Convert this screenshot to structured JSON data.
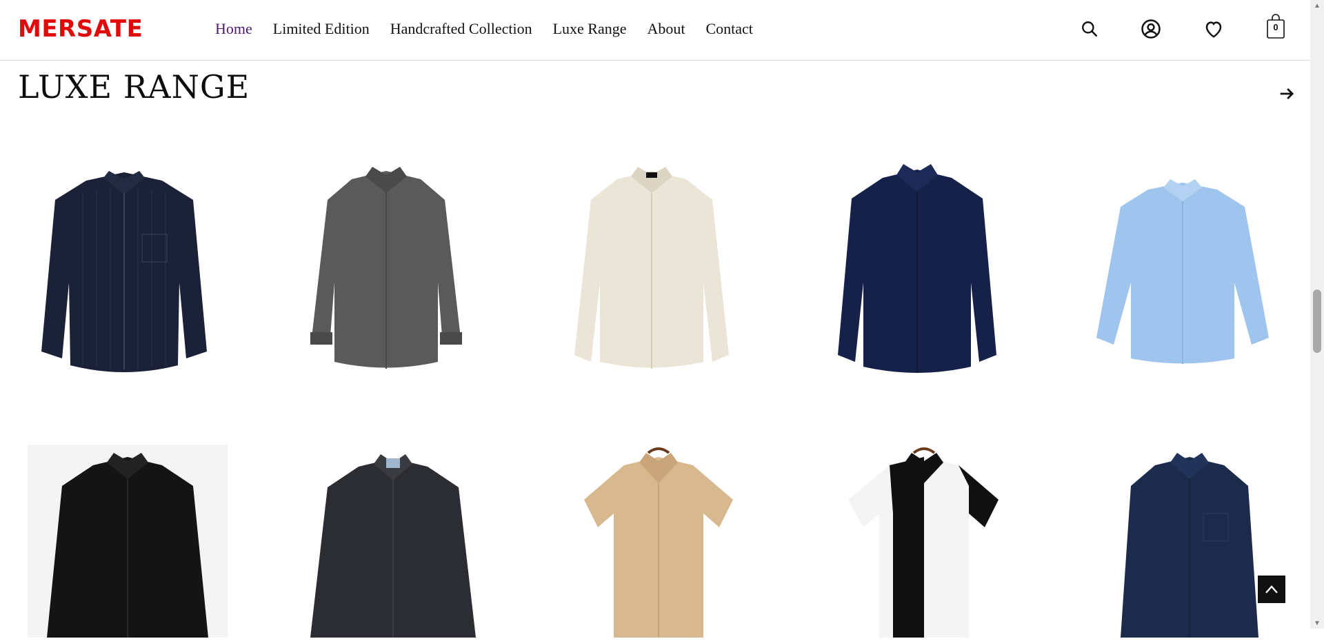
{
  "brand": {
    "logo_text": "MERSATE",
    "color": "#e10a0a"
  },
  "nav": {
    "items": [
      {
        "label": "Home",
        "active": true
      },
      {
        "label": "Limited Edition"
      },
      {
        "label": "Handcrafted Collection"
      },
      {
        "label": "Luxe Range"
      },
      {
        "label": "About"
      },
      {
        "label": "Contact"
      }
    ],
    "active_color": "#4b1a6e"
  },
  "header_icons": {
    "search": "search-icon",
    "account": "user-icon",
    "wishlist": "heart-icon",
    "cart": "shopping-bag-icon",
    "cart_count": "0"
  },
  "section": {
    "title": "LUXE RANGE",
    "next_icon": "arrow-right-icon"
  },
  "products": [
    {
      "name": "navy-pinstripe-shirt",
      "color": "#1b2136"
    },
    {
      "name": "charcoal-grey-shirt",
      "color": "#5a5a5a"
    },
    {
      "name": "beige-linen-shirt",
      "color": "#ebe5d8"
    },
    {
      "name": "navy-dress-shirt",
      "color": "#16214a"
    },
    {
      "name": "light-blue-shirt",
      "color": "#9fc5ee"
    },
    {
      "name": "black-shirt",
      "color": "#141414"
    },
    {
      "name": "charcoal-button-down-shirt",
      "color": "#2c2d32"
    },
    {
      "name": "tan-short-sleeve-shirt",
      "color": "#d8b88f"
    },
    {
      "name": "black-white-colorblock-shirt",
      "color": "#101010"
    },
    {
      "name": "navy-pocket-shirt",
      "color": "#1c2a4b"
    }
  ],
  "back_to_top_icon": "chevron-up-icon"
}
